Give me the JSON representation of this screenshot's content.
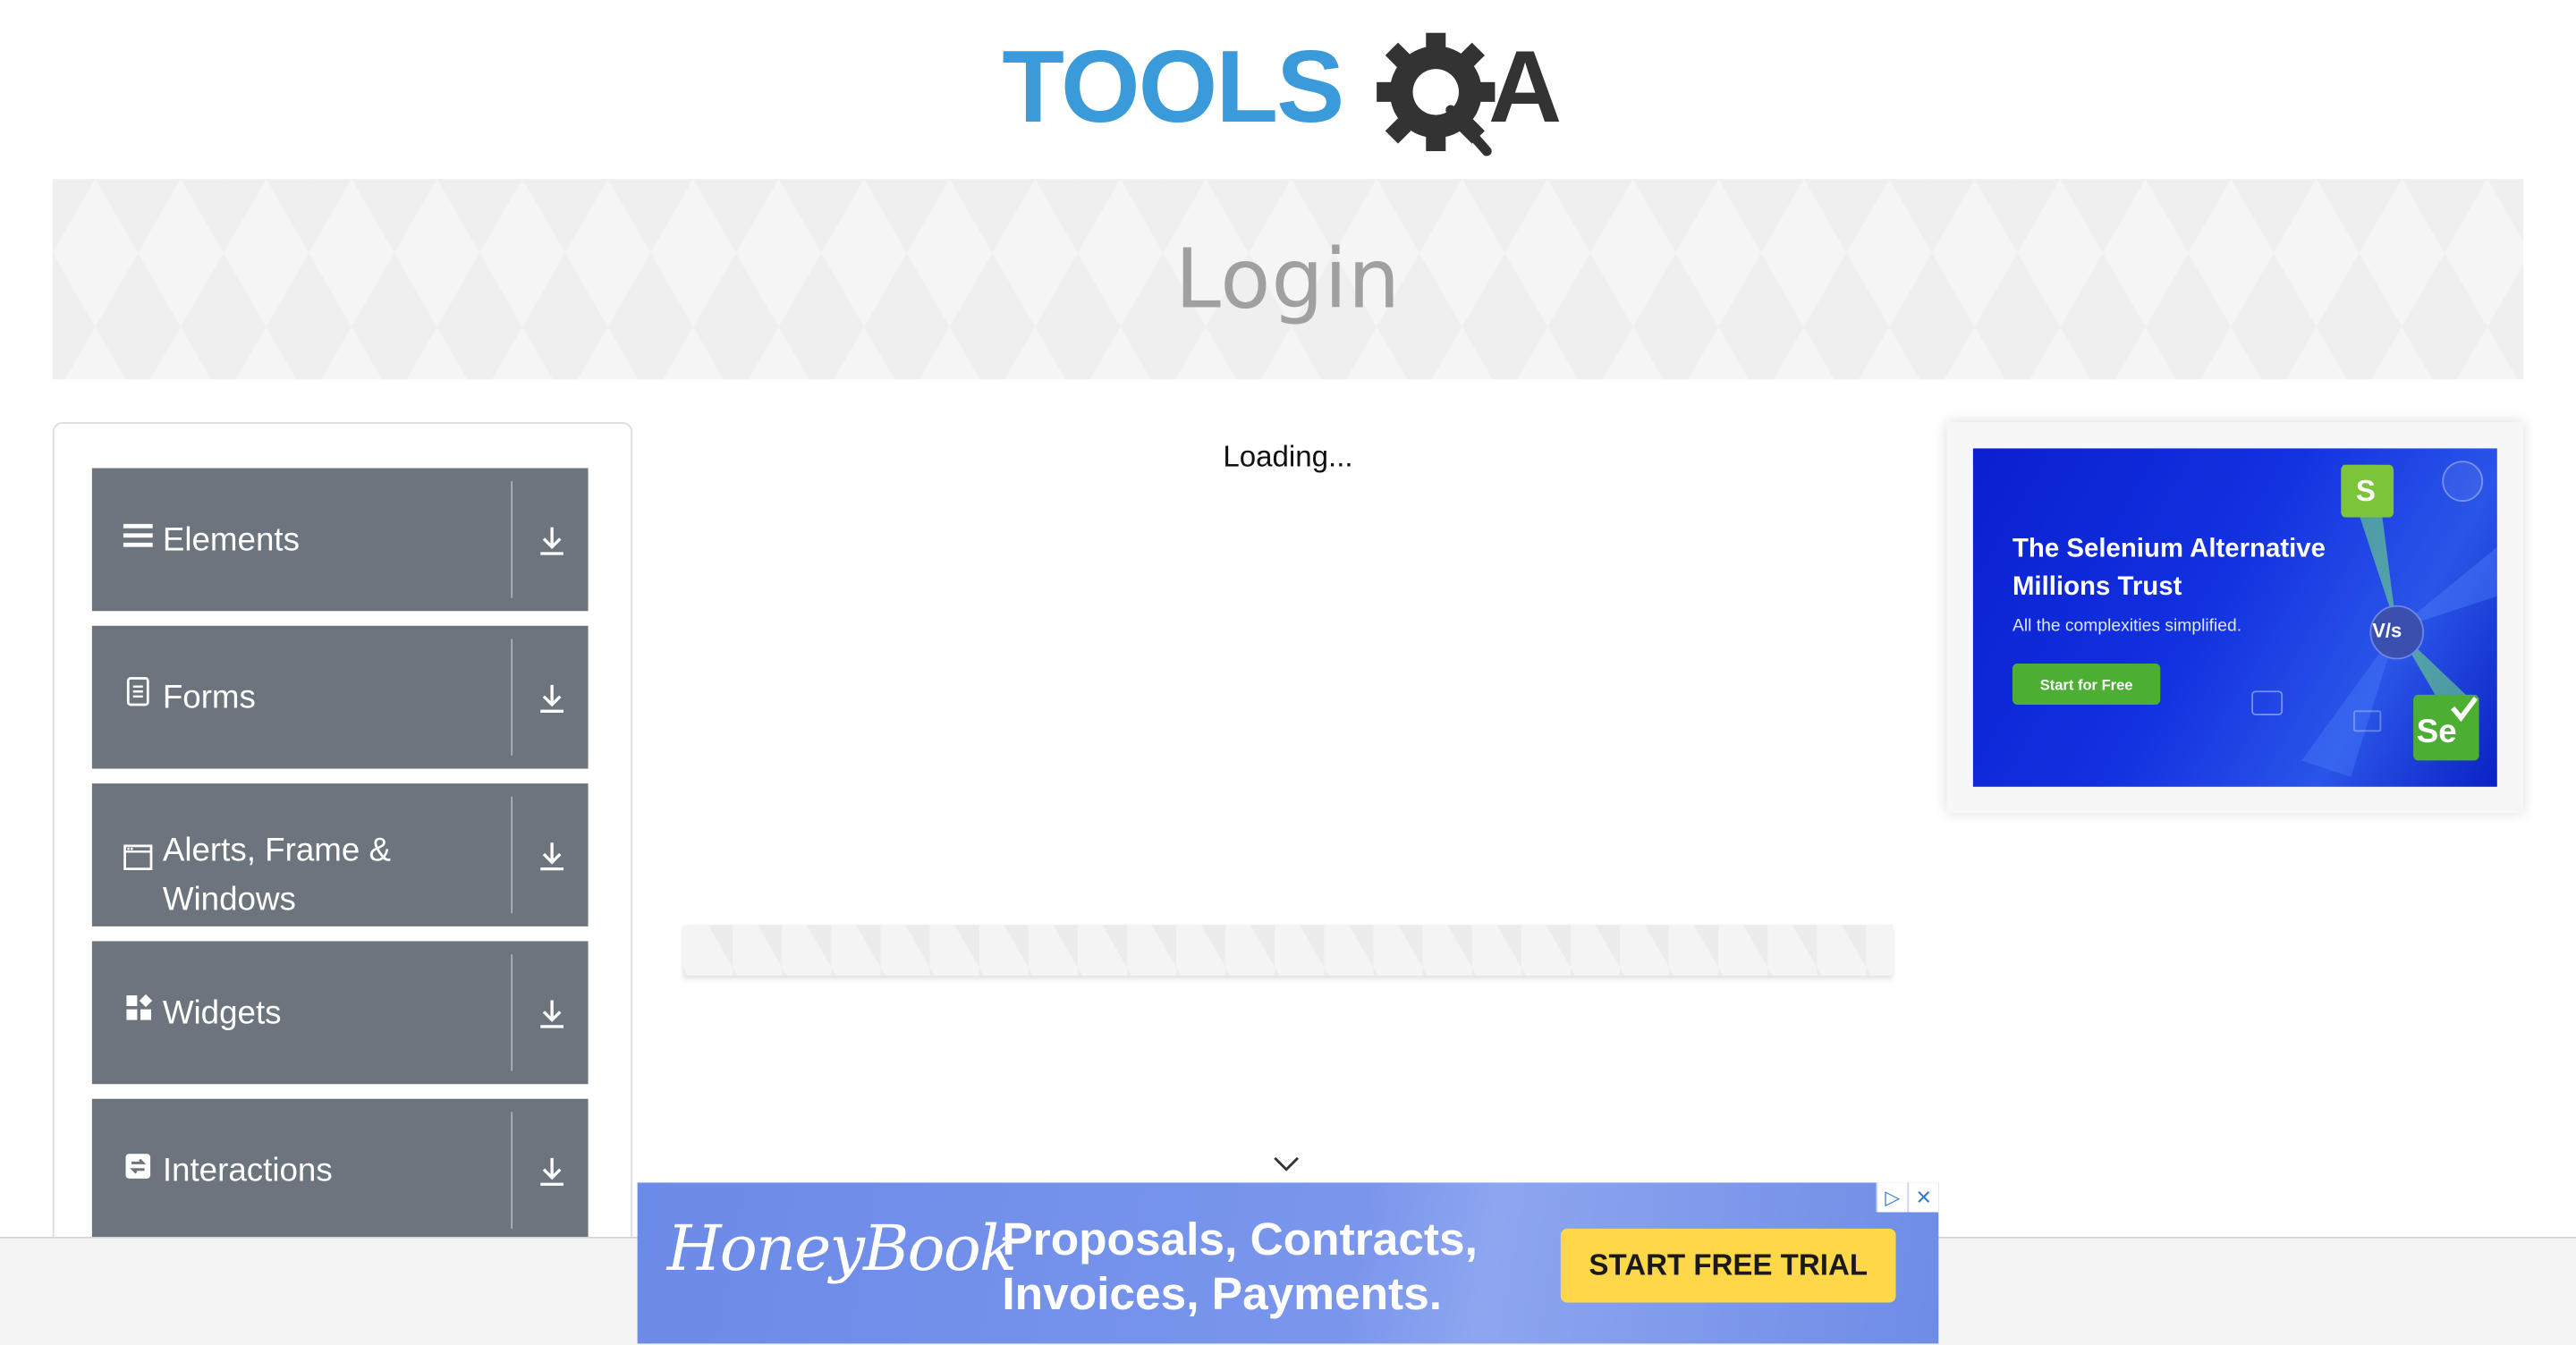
{
  "header": {
    "logo_left": "TOOLS",
    "logo_right": "QA"
  },
  "banner": {
    "title": "Login"
  },
  "sidebar": {
    "groups": [
      {
        "label": "Elements",
        "icon": "menu-lines-icon"
      },
      {
        "label": "Forms",
        "icon": "document-icon"
      },
      {
        "label": "Alerts, Frame & Windows",
        "icon": "window-icon"
      },
      {
        "label": "Widgets",
        "icon": "widgets-icon"
      },
      {
        "label": "Interactions",
        "icon": "interactions-icon"
      }
    ]
  },
  "main": {
    "loading_text": "Loading..."
  },
  "right_ad": {
    "headline": "The Selenium Alternative Millions Trust",
    "subtext": "All the complexities simplified.",
    "cta": "Start for Free",
    "badge_s": "S",
    "badge_vs": "V/s",
    "badge_se": "Se"
  },
  "bottom_ad": {
    "brand": "HoneyBook",
    "copy": "Proposals, Contracts, Invoices, Payments.",
    "cta": "START FREE TRIAL"
  },
  "colors": {
    "logo_blue": "#3b9ad9",
    "logo_dark": "#333333",
    "nav_group_bg": "#6c757d",
    "trial_button": "#ffd84a",
    "selenium_cta": "#4caf33"
  }
}
